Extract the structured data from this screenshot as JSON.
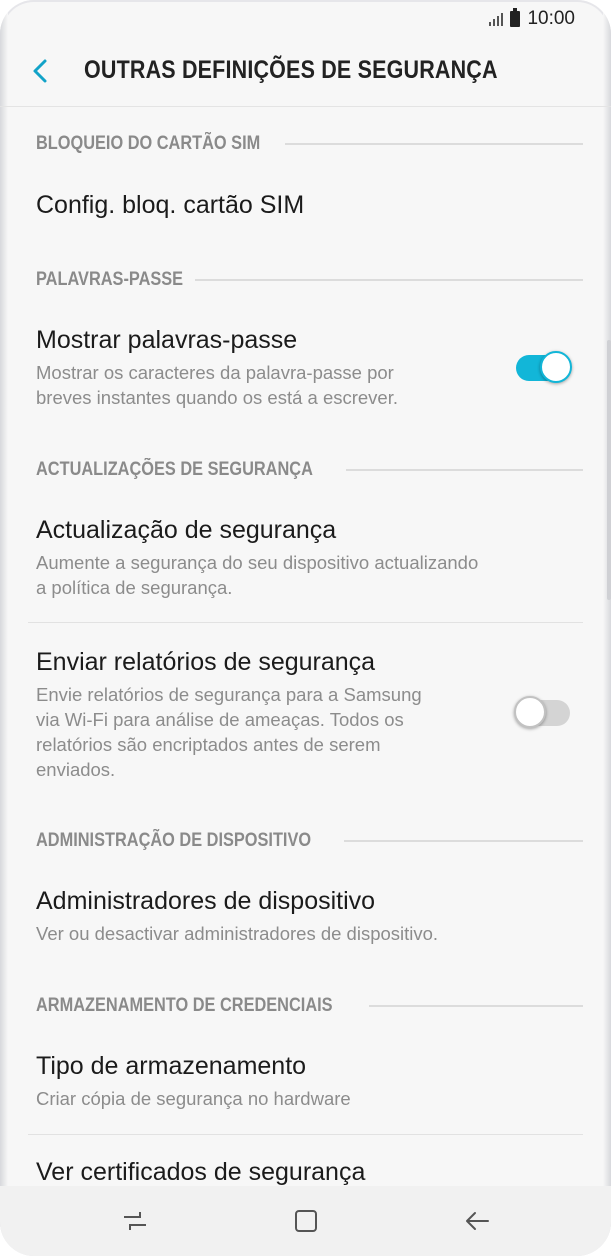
{
  "status_bar": {
    "time": "10:00"
  },
  "header": {
    "title": "OUTRAS DEFINIÇÕES DE SEGURANÇA"
  },
  "sections": [
    {
      "header": "BLOQUEIO DO CARTÃO SIM",
      "items": [
        {
          "title": "Config. bloq. cartão SIM"
        }
      ]
    },
    {
      "header": "PALAVRAS-PASSE",
      "items": [
        {
          "title": "Mostrar palavras-passe",
          "subtitle_lines": [
            "Mostrar os caracteres da palavra-passe por",
            "breves instantes quando os está a escrever."
          ],
          "toggle": "on"
        }
      ]
    },
    {
      "header": "ACTUALIZAÇÕES DE SEGURANÇA",
      "items": [
        {
          "title": "Actualização de segurança",
          "subtitle_lines": [
            "Aumente a segurança do seu dispositivo actualizando",
            "a política de segurança."
          ]
        },
        {
          "title": "Enviar relatórios de segurança",
          "subtitle_lines": [
            "Envie relatórios de segurança para a Samsung",
            "via Wi-Fi para análise de ameaças. Todos os",
            "relatórios são encriptados antes de serem",
            "enviados."
          ],
          "toggle": "off"
        }
      ]
    },
    {
      "header": "ADMINISTRAÇÃO DE DISPOSITIVO",
      "items": [
        {
          "title": "Administradores de dispositivo",
          "subtitle_lines": [
            "Ver ou desactivar administradores de dispositivo."
          ]
        }
      ]
    },
    {
      "header": "ARMAZENAMENTO DE CREDENCIAIS",
      "items": [
        {
          "title": "Tipo de armazenamento",
          "subtitle_lines": [
            "Criar cópia de segurança no hardware"
          ]
        },
        {
          "title": "Ver certificados de segurança"
        }
      ]
    }
  ],
  "colors": {
    "accent": "#12b6d8",
    "section_header": "#8a8a8a"
  },
  "nav_bar": {
    "icons": [
      "recents-icon",
      "home-icon",
      "back-icon"
    ]
  }
}
